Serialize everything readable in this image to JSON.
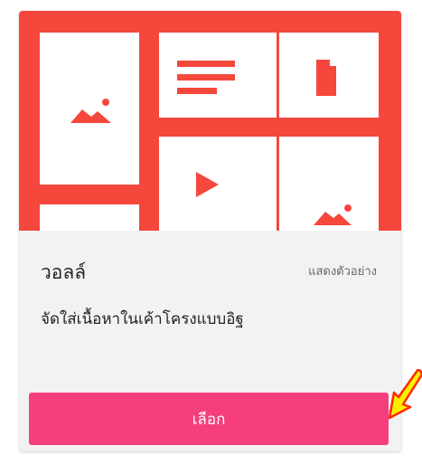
{
  "card": {
    "title": "วอลล์",
    "preview_label": "แสดงตัวอย่าง",
    "description": "จัดใส่เนื้อหาในเค้าโครงแบบอิฐ",
    "select_label": "เลือก"
  },
  "icons": {
    "thumbnail": "wall-layout-thumbnail",
    "image": "image-icon",
    "text": "text-lines-icon",
    "document": "document-icon",
    "video": "play-icon",
    "pointer": "arrow-pointer-icon"
  },
  "colors": {
    "thumbnail_background": "#f5473c",
    "tile": "#ffffff",
    "button": "#f43f7c",
    "button_text": "#ffffff",
    "card_background": "#f2f2f2",
    "annotation_arrow": "#ff2a00",
    "annotation_arrow_fill": "#ffee00"
  }
}
